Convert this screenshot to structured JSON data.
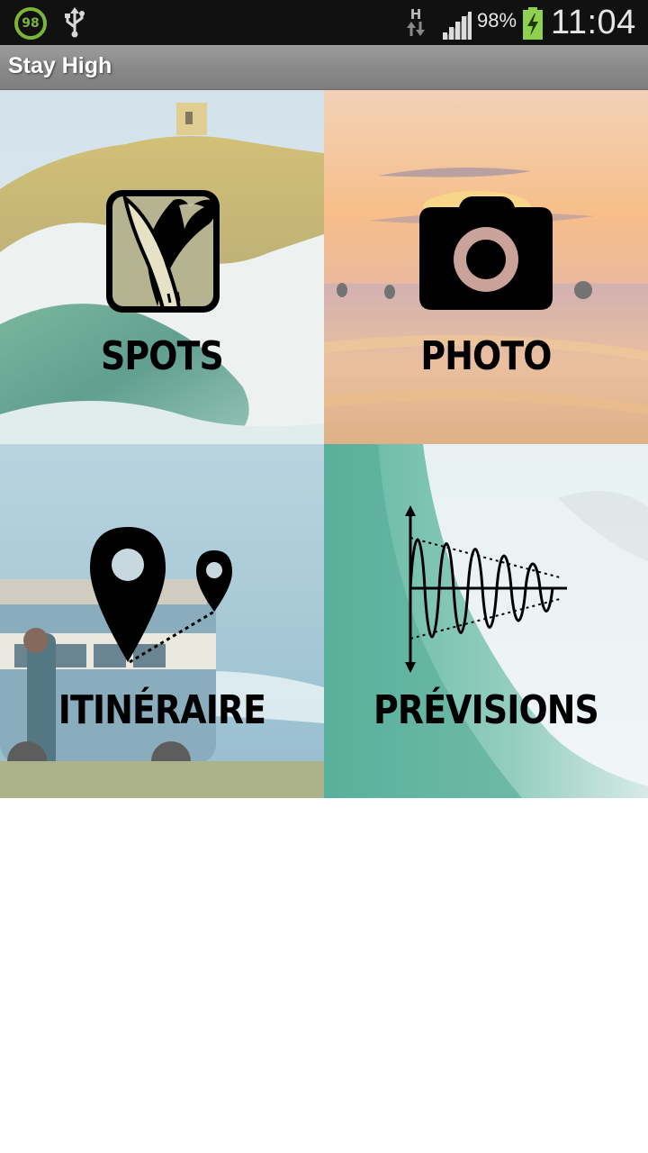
{
  "status_bar": {
    "badge_number": "98",
    "network_type": "H",
    "battery_percent": "98%",
    "time": "11:04",
    "icons": [
      "usb-icon",
      "data-arrows-icon",
      "signal-icon",
      "battery-charging-icon"
    ]
  },
  "action_bar": {
    "title": "Stay High"
  },
  "tiles": [
    {
      "label": "SPOTS",
      "icon": "surfboard-wave-icon"
    },
    {
      "label": "PHOTO",
      "icon": "camera-icon"
    },
    {
      "label": "ITINÉRAIRE",
      "icon": "map-pins-icon"
    },
    {
      "label": "PRÉVISIONS",
      "icon": "wave-chart-icon"
    }
  ]
}
